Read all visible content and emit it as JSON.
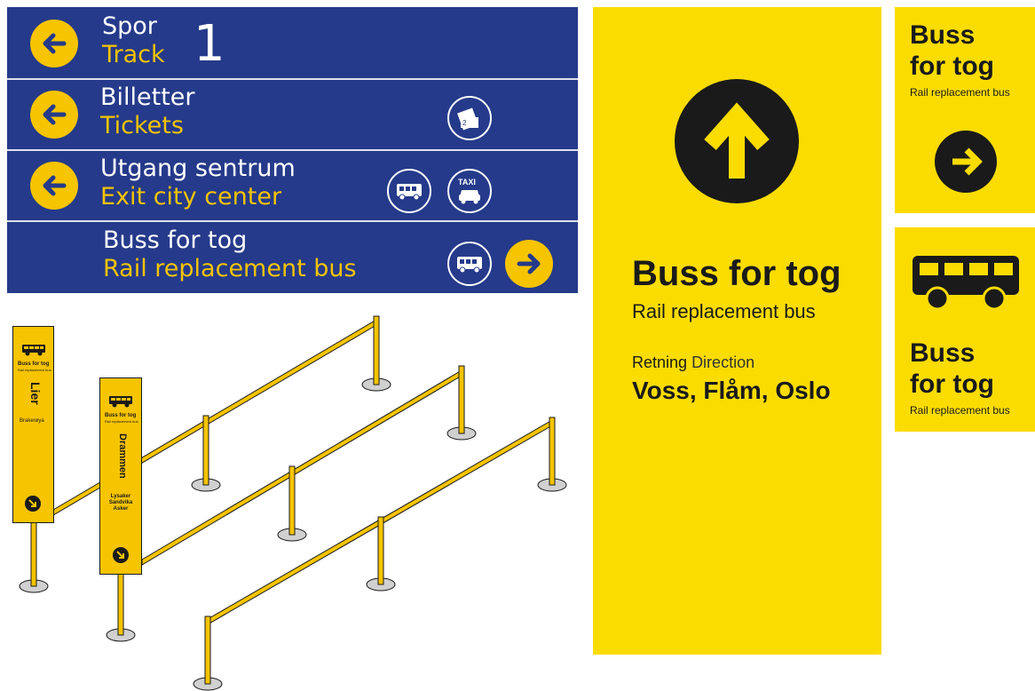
{
  "blue_board": {
    "rows": [
      {
        "line1": "Spor",
        "line2": "Track",
        "number": "1",
        "arrow": "arrow-left-icon"
      },
      {
        "line1": "Billetter",
        "line2": "Tickets",
        "arrow": "arrow-left-icon",
        "icon": "ticket-icon",
        "ticket_number": "2"
      },
      {
        "line1": "Utgang sentrum",
        "line2": "Exit city center",
        "arrow": "arrow-left-icon",
        "icons": [
          "bus-icon",
          "taxi-icon"
        ],
        "taxi_label": "TAXI"
      },
      {
        "line1": "Buss for tog",
        "line2": "Rail replacement bus",
        "arrow": "arrow-right-icon",
        "icon": "bus-icon"
      }
    ],
    "colors": {
      "background": "#253a8a",
      "accent": "#f6c400",
      "text": "#ffffff"
    }
  },
  "big_panel": {
    "title": "Buss for tog",
    "subtitle": "Rail replacement bus",
    "direction_no": "Retning",
    "direction_en": "Direction",
    "destinations": "Voss, Flåm, Oslo",
    "arrow": "arrow-up-icon",
    "color": "#fbdc00"
  },
  "small_panel_top": {
    "title_line1": "Buss",
    "title_line2": "for tog",
    "subtitle": "Rail replacement bus",
    "arrow": "arrow-right-icon"
  },
  "small_panel_bottom": {
    "title_line1": "Buss",
    "title_line2": "for tog",
    "subtitle": "Rail replacement bus",
    "icon": "bus-icon"
  },
  "totem_lier": {
    "label": "Buss for tog",
    "sublabel": "Rail replacement bus",
    "destination": "Lier",
    "stops": "Brakerøya",
    "arrow": "arrow-down-right-icon"
  },
  "totem_drammen": {
    "label": "Buss for tog",
    "sublabel": "Rail replacement bus",
    "destination": "Drammen",
    "stops": [
      "Lysaker",
      "Sandvika",
      "Asker"
    ],
    "arrow": "arrow-down-right-icon"
  }
}
